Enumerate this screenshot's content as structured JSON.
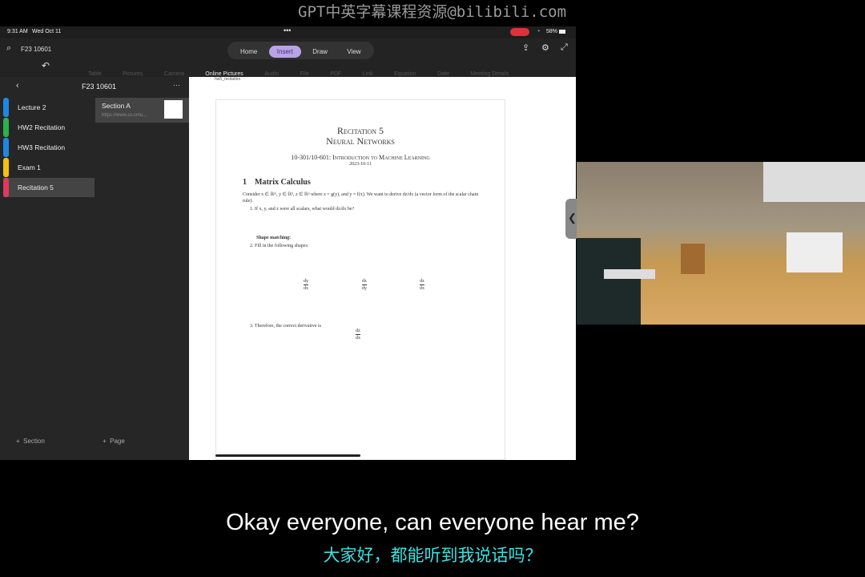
{
  "watermark": "GPT中英字幕课程资源@bilibili.com",
  "status": {
    "time": "9:31 AM",
    "date": "Wed Oct 11",
    "battery": "58%"
  },
  "toolbar": {
    "notebook": "F23 10601",
    "tabs": [
      "Home",
      "Insert",
      "Draw",
      "View"
    ],
    "active_tab": "Insert",
    "tools": [
      "Table",
      "Pictures",
      "Camera",
      "Online Pictures",
      "Audio",
      "File",
      "PDF",
      "Link",
      "Equation",
      "Date",
      "Meeting Details"
    ]
  },
  "sidebar": {
    "title": "F23 10601",
    "sections": [
      {
        "label": "Lecture 2",
        "color": "#1e88e5"
      },
      {
        "label": "HW2 Recitation",
        "color": "#2bb24c"
      },
      {
        "label": "HW3 Recitation",
        "color": "#1e88e5"
      },
      {
        "label": "Exam 1",
        "color": "#f4c20d"
      },
      {
        "label": "Recitation 5",
        "color": "#e0395f"
      }
    ],
    "page": {
      "title": "Section A",
      "url": "https://www.cs.cmu..."
    },
    "add_section": "Section",
    "add_page": "Page"
  },
  "doc": {
    "page_label": "hw5_recitation",
    "title1": "Recitation 5",
    "title2": "Neural Networks",
    "course": "10-301/10-601: Introduction to Machine Learning",
    "date": "2023-10-11",
    "section": "1    Matrix Calculus",
    "intro": "Consider x ∈ ℝᵐ, y ∈ ℝⁿ, z ∈ ℝᵖ where z = g(y), and y = f(x). We want to derive dz/dx (a vector form of the scalar chain rule).",
    "q1": "1. If x, y, and z were all scalars, what would dz/dx be?",
    "shape": "Shape matching:",
    "q2": "2. Fill in the following shapes:",
    "fracs": [
      [
        "dy",
        "dx"
      ],
      [
        "dz",
        "dy"
      ],
      [
        "dz",
        "dx"
      ]
    ],
    "q3": "3. Therefore, the correct derivative is",
    "q3frac": [
      "dz",
      "dx"
    ]
  },
  "subtitles": {
    "en": "Okay everyone, can everyone hear me?",
    "zh": "大家好，都能听到我说话吗？"
  }
}
